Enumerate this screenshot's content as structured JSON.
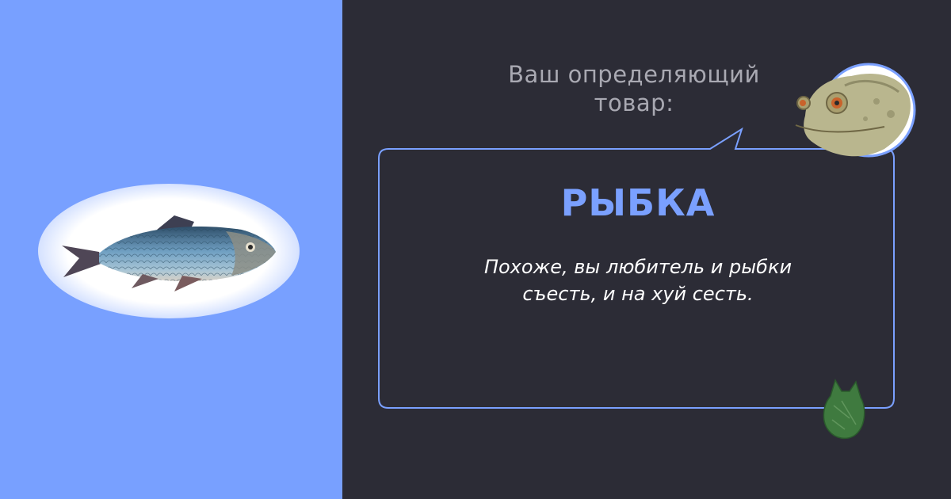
{
  "heading": "Ваш определяющий\nтовар:",
  "heading_line1": "Ваш определяющий",
  "heading_line2": "товар:",
  "product": {
    "name": "РЫБКА",
    "description_line1": "Похоже, вы любитель и рыбки",
    "description_line2": "съесть, и на хуй сесть."
  },
  "colors": {
    "left_bg": "#78a0ff",
    "right_bg": "#2c2c36",
    "accent": "#7aa0ff",
    "heading_text": "#a9a9b2",
    "description_text": "#ffffff"
  },
  "images": {
    "fish": "fish-illustration",
    "toad": "toad-avatar",
    "bag": "plastic-bag-icon"
  }
}
